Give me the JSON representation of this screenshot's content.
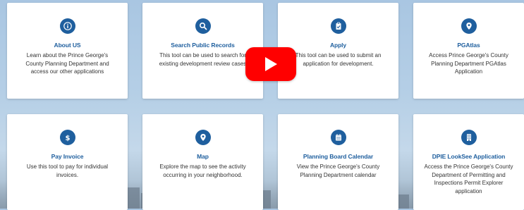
{
  "colors": {
    "accent": "#1f5f9e",
    "play": "#ff0000"
  },
  "cards": [
    {
      "title": "About US",
      "icon": "info-icon",
      "desc": [
        "Learn about the Prince George's",
        "County Planning Department and",
        "access our other applications"
      ]
    },
    {
      "title": "Search Public Records",
      "icon": "search-icon",
      "desc": [
        "This tool can be used to search for",
        "existing development review cases"
      ]
    },
    {
      "title": "Apply",
      "icon": "clipboard-icon",
      "desc": [
        "This tool can be used to submit an",
        "application for development."
      ]
    },
    {
      "title": "PGAtlas",
      "icon": "map-pin-icon",
      "desc": [
        "Access Prince George's County",
        "Planning Department PGAtlas",
        "Application"
      ]
    },
    {
      "title": "Pay Invoice",
      "icon": "dollar-icon",
      "desc": [
        "Use this tool to pay for individual",
        "invoices."
      ]
    },
    {
      "title": "Map",
      "icon": "map-pin-icon",
      "desc": [
        "Explore the map to see the activity",
        "occurring in your neighborhood."
      ]
    },
    {
      "title": "Planning Board Calendar",
      "icon": "calendar-icon",
      "desc": [
        "View the Prince George's County",
        "Planning Department calendar"
      ]
    },
    {
      "title": "DPIE LookSee Application",
      "icon": "building-icon",
      "desc": [
        "Access the Prince George's County",
        "Department of Permitting and",
        "Inspections Permit Explorer",
        "application"
      ]
    }
  ]
}
